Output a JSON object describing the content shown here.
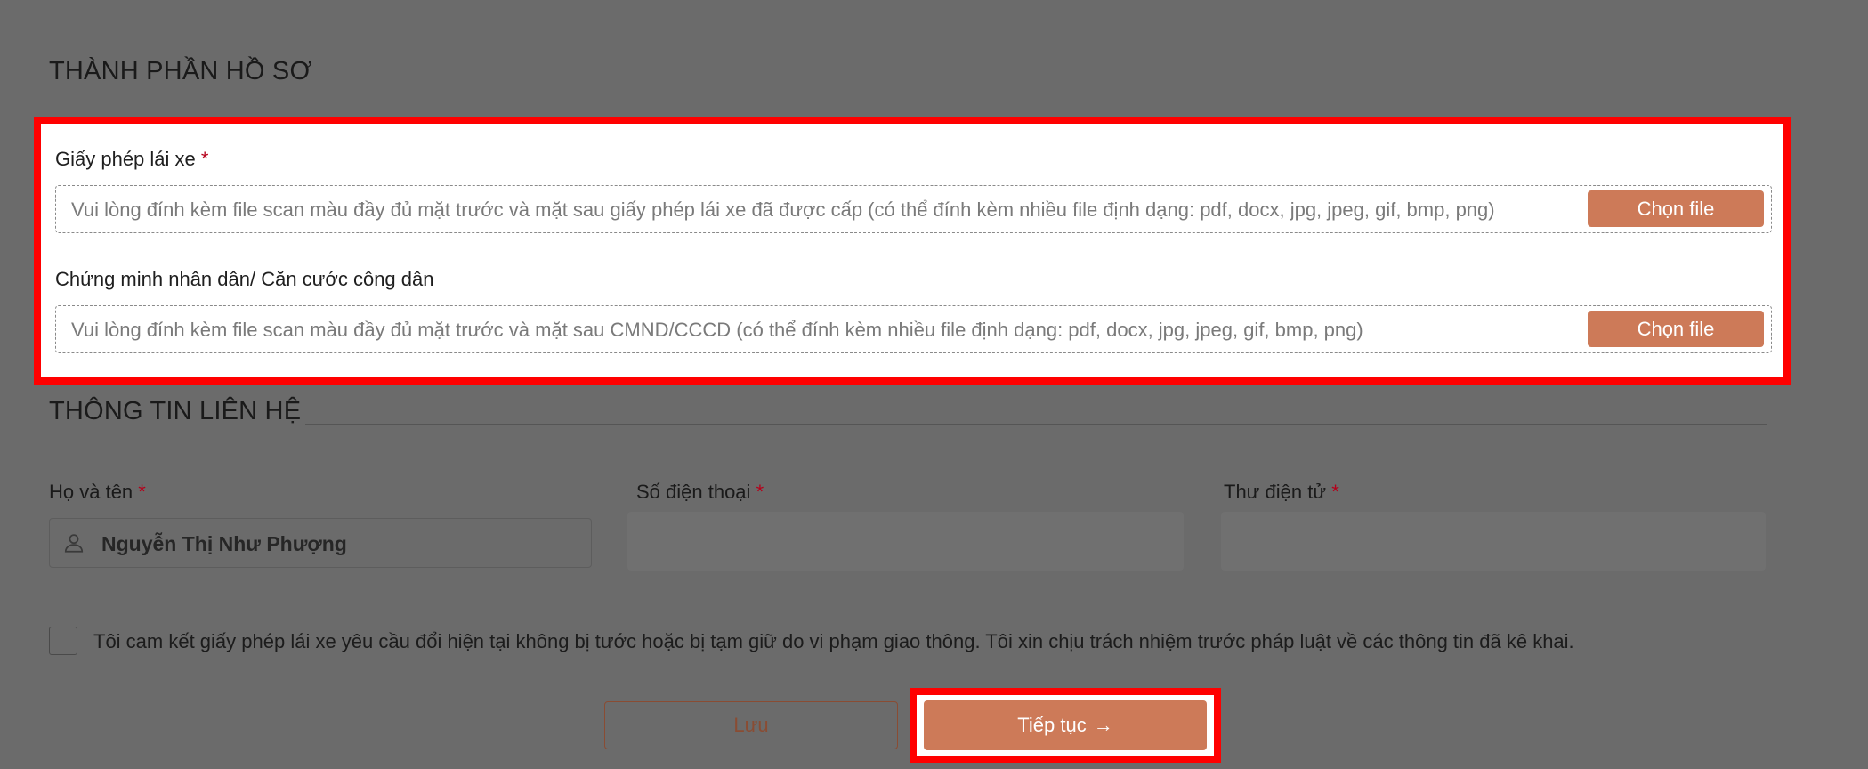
{
  "sections": {
    "documents_title": "THÀNH PHẦN HỒ SƠ",
    "contact_title": "THÔNG TIN LIÊN HỆ"
  },
  "documents": [
    {
      "label": "Giấy phép lái xe",
      "required_mark": "*",
      "hint": "Vui lòng đính kèm file scan màu đầy đủ mặt trước và mặt sau giấy phép lái xe đã được cấp (có thể đính kèm nhiều file định dạng: pdf, docx, jpg, jpeg, gif, bmp, png)",
      "button": "Chọn file"
    },
    {
      "label": "Chứng minh nhân dân/ Căn cước công dân",
      "hint": "Vui lòng đính kèm file scan màu đầy đủ mặt trước và mặt sau CMND/CCCD (có thể đính kèm nhiều file định dạng: pdf, docx, jpg, jpeg, gif, bmp, png)",
      "button": "Chọn file"
    }
  ],
  "contact": {
    "name_label": "Họ và tên",
    "name_value": "Nguyễn Thị Như Phượng",
    "phone_label": "Số điện thoại",
    "email_label": "Thư điện tử",
    "required_mark": "*"
  },
  "commitment": "Tôi cam kết giấy phép lái xe yêu cầu đổi hiện tại không bị tước hoặc bị tạm giữ do vi phạm giao thông. Tôi xin chịu trách nhiệm trước pháp luật về các thông tin đã kê khai.",
  "actions": {
    "save": "Lưu",
    "continue": "Tiếp tục",
    "continue_arrow": "→"
  },
  "colors": {
    "accent": "#cd7a58",
    "highlight": "#ff0000",
    "overlay": "#6b6b6b",
    "required": "#b5001a"
  }
}
